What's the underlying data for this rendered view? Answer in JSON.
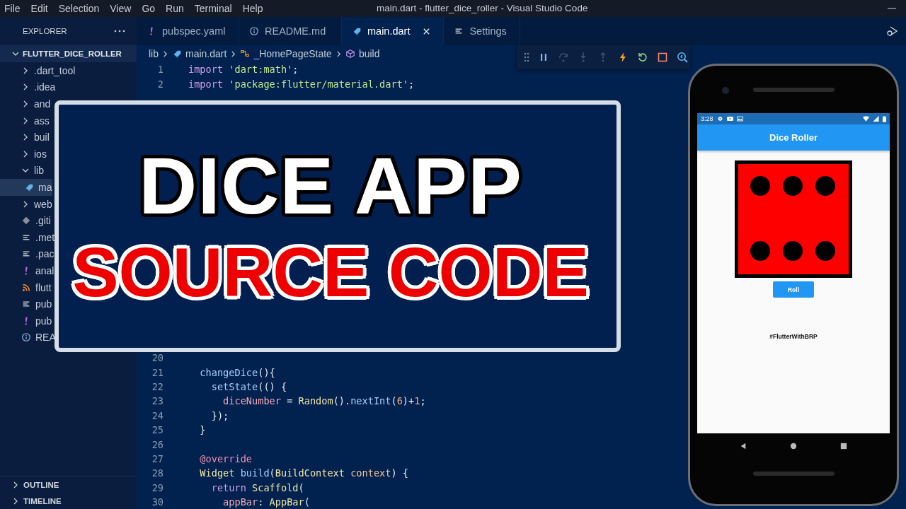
{
  "window": {
    "title": "main.dart - flutter_dice_roller - Visual Studio Code",
    "menu": [
      "File",
      "Edit",
      "Selection",
      "View",
      "Go",
      "Run",
      "Terminal",
      "Help"
    ]
  },
  "explorer": {
    "title": "EXPLORER",
    "project": {
      "label": "FLUTTER_DICE_ROLLER",
      "expanded": true
    },
    "items": [
      {
        "label": ".dart_tool",
        "kind": "folder",
        "expanded": false,
        "selected": false
      },
      {
        "label": ".idea",
        "kind": "folder",
        "expanded": false,
        "selected": false
      },
      {
        "label": "and",
        "kind": "folder",
        "expanded": false,
        "selected": false
      },
      {
        "label": "ass",
        "kind": "folder",
        "expanded": false,
        "selected": false
      },
      {
        "label": "buil",
        "kind": "folder",
        "expanded": false,
        "selected": false
      },
      {
        "label": "ios",
        "kind": "folder",
        "expanded": false,
        "selected": false
      },
      {
        "label": "lib",
        "kind": "folder",
        "expanded": true,
        "selected": false,
        "children": [
          {
            "label": "ma",
            "kind": "dart",
            "selected": true
          }
        ]
      },
      {
        "label": "web",
        "kind": "folder",
        "expanded": false,
        "selected": false
      },
      {
        "label": ".giti",
        "kind": "git",
        "selected": false
      },
      {
        "label": ".met",
        "kind": "lines",
        "selected": false
      },
      {
        "label": ".pac",
        "kind": "lines",
        "selected": false
      },
      {
        "label": "anal",
        "kind": "exclam",
        "selected": false
      },
      {
        "label": "flutt",
        "kind": "rss",
        "selected": false
      },
      {
        "label": "pub",
        "kind": "lines",
        "selected": false
      },
      {
        "label": "pub",
        "kind": "exclam",
        "selected": false
      },
      {
        "label": "REA",
        "kind": "info",
        "selected": false
      }
    ],
    "panels": [
      {
        "label": "OUTLINE",
        "expanded": false
      },
      {
        "label": "TIMELINE",
        "expanded": false
      }
    ]
  },
  "tabs": [
    {
      "label": "pubspec.yaml",
      "kind": "exclam",
      "selected": false
    },
    {
      "label": "README.md",
      "kind": "info",
      "selected": false
    },
    {
      "label": "main.dart",
      "kind": "dart",
      "selected": true
    },
    {
      "label": "Settings",
      "kind": "lines",
      "selected": false
    }
  ],
  "breadcrumb": [
    {
      "label": "lib",
      "kind": "folder"
    },
    {
      "label": "main.dart",
      "kind": "dart"
    },
    {
      "label": "_HomePageState",
      "kind": "class"
    },
    {
      "label": "build",
      "kind": "method"
    }
  ],
  "debug_toolbar": [
    {
      "kind": "pause",
      "disabled": false
    },
    {
      "kind": "step-over",
      "disabled": true
    },
    {
      "kind": "step-into",
      "disabled": true
    },
    {
      "kind": "step-out",
      "disabled": true
    },
    {
      "kind": "hot-reload",
      "disabled": false
    },
    {
      "kind": "restart",
      "disabled": false
    },
    {
      "kind": "stop",
      "disabled": false
    },
    {
      "kind": "devtools",
      "disabled": false
    }
  ],
  "code": {
    "lines_before": [
      {
        "number": "1",
        "tokens": [
          {
            "text": "import ",
            "kind": "keyword"
          },
          {
            "text": "'dart:math'",
            "kind": "string"
          },
          {
            "text": ";",
            "kind": "punct"
          }
        ]
      },
      {
        "number": "2",
        "tokens": [
          {
            "text": "import ",
            "kind": "keyword"
          },
          {
            "text": "'package:flutter/material.dart'",
            "kind": "string"
          },
          {
            "text": ";",
            "kind": "punct"
          }
        ]
      }
    ],
    "lines_after": [
      {
        "number": "20"
      },
      {
        "number": "21",
        "tokens": [
          {
            "text": "  changeDice",
            "kind": "fn"
          },
          {
            "text": "(){",
            "kind": "punct"
          }
        ]
      },
      {
        "number": "22",
        "tokens": [
          {
            "text": "    setState",
            "kind": "fn"
          },
          {
            "text": "(() {",
            "kind": "punct"
          }
        ]
      },
      {
        "number": "23",
        "tokens": [
          {
            "text": "      diceNumber",
            "kind": "var"
          },
          {
            "text": " = ",
            "kind": "punct"
          },
          {
            "text": "Random",
            "kind": "type"
          },
          {
            "text": "().",
            "kind": "punct"
          },
          {
            "text": "nextInt",
            "kind": "fn"
          },
          {
            "text": "(",
            "kind": "punct"
          },
          {
            "text": "6",
            "kind": "number"
          },
          {
            "text": ")+",
            "kind": "punct"
          },
          {
            "text": "1",
            "kind": "number"
          },
          {
            "text": ";",
            "kind": "punct"
          }
        ]
      },
      {
        "number": "24",
        "tokens": [
          {
            "text": "    });",
            "kind": "punct"
          }
        ]
      },
      {
        "number": "25",
        "tokens": [
          {
            "text": "  }",
            "kind": "punct"
          }
        ]
      },
      {
        "number": "26"
      },
      {
        "number": "27",
        "tokens": [
          {
            "text": "  @override",
            "kind": "decorator"
          }
        ]
      },
      {
        "number": "28",
        "tokens": [
          {
            "text": "  Widget ",
            "kind": "type"
          },
          {
            "text": "build",
            "kind": "fn"
          },
          {
            "text": "(",
            "kind": "punct"
          },
          {
            "text": "BuildContext ",
            "kind": "type"
          },
          {
            "text": "context",
            "kind": "param"
          },
          {
            "text": ") {",
            "kind": "punct"
          }
        ]
      },
      {
        "number": "29",
        "tokens": [
          {
            "text": "    return ",
            "kind": "keyword"
          },
          {
            "text": "Scaffold",
            "kind": "type"
          },
          {
            "text": "(",
            "kind": "punct"
          }
        ]
      },
      {
        "number": "30",
        "tokens": [
          {
            "text": "      appBar",
            "kind": "var"
          },
          {
            "text": ": ",
            "kind": "punct"
          },
          {
            "text": "AppBar",
            "kind": "type"
          },
          {
            "text": "(",
            "kind": "punct"
          }
        ]
      }
    ]
  },
  "overlay": {
    "title": "DICE APP",
    "subtitle": "SOURCE CODE"
  },
  "phone": {
    "time": "3:28",
    "app_title": "Dice Roller",
    "button": "Roll",
    "caption": "#FlutterWithBRP"
  }
}
